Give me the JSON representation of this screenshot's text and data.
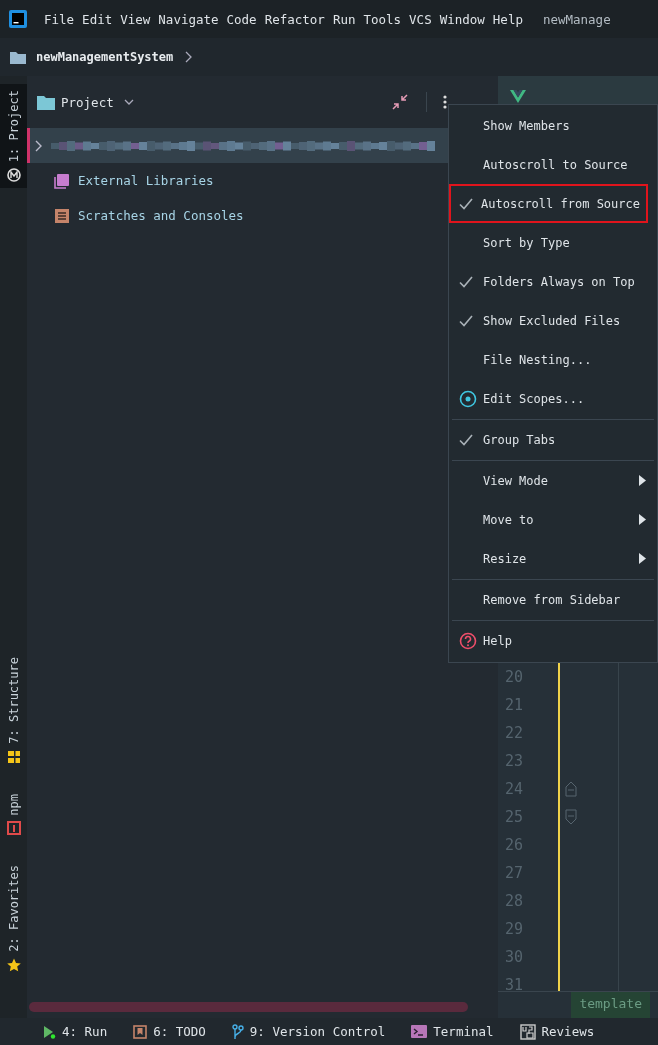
{
  "menubar": {
    "items": [
      "File",
      "Edit",
      "View",
      "Navigate",
      "Code",
      "Refactor",
      "Run",
      "Tools",
      "VCS",
      "Window",
      "Help"
    ],
    "title": "newManage"
  },
  "breadcrumb": {
    "items": [
      "newManagementSystem"
    ]
  },
  "left_toolbar": {
    "top": [
      {
        "label": "1: Project",
        "selected": true
      }
    ],
    "bottom": [
      {
        "label": "7: Structure",
        "selected": false
      },
      {
        "label": "npm",
        "selected": false
      },
      {
        "label": "2: Favorites",
        "selected": false
      }
    ]
  },
  "project_panel": {
    "title": "Project",
    "tree": [
      {
        "kind": "folder",
        "selected": true
      },
      {
        "kind": "libraries",
        "label": "External Libraries",
        "selected": false
      },
      {
        "kind": "scratches",
        "label": "Scratches and Consoles",
        "selected": false
      }
    ]
  },
  "context_menu": {
    "items": [
      {
        "kind": "toggle",
        "label": "Show Members",
        "checked": false,
        "highlighted": false
      },
      {
        "kind": "toggle",
        "label": "Autoscroll to Source",
        "checked": false,
        "highlighted": false
      },
      {
        "kind": "toggle",
        "label": "Autoscroll from Source",
        "checked": true,
        "highlighted": true
      },
      {
        "kind": "toggle",
        "label": "Sort by Type",
        "checked": false,
        "highlighted": false
      },
      {
        "kind": "toggle",
        "label": "Folders Always on Top",
        "checked": true,
        "highlighted": false
      },
      {
        "kind": "toggle",
        "label": "Show Excluded Files",
        "checked": true,
        "highlighted": false
      },
      {
        "kind": "action",
        "label": "File Nesting...",
        "highlighted": false
      },
      {
        "kind": "scopes",
        "label": "Edit Scopes...",
        "highlighted": false
      },
      {
        "kind": "separator"
      },
      {
        "kind": "toggle",
        "label": "Group Tabs",
        "checked": true,
        "highlighted": false
      },
      {
        "kind": "separator"
      },
      {
        "kind": "submenu",
        "label": "View Mode",
        "highlighted": false
      },
      {
        "kind": "submenu",
        "label": "Move to",
        "highlighted": false
      },
      {
        "kind": "submenu",
        "label": "Resize",
        "highlighted": false
      },
      {
        "kind": "separator"
      },
      {
        "kind": "action",
        "label": "Remove from Sidebar",
        "highlighted": false
      },
      {
        "kind": "separator"
      },
      {
        "kind": "help",
        "label": "Help",
        "highlighted": false
      }
    ]
  },
  "editor": {
    "line_numbers": [
      "20",
      "21",
      "22",
      "23",
      "24",
      "25",
      "26",
      "27",
      "28",
      "29",
      "30",
      "31"
    ],
    "breadcrumb": "template"
  },
  "bottom_toolbar": {
    "items": [
      "4: Run",
      "6: TODO",
      "9: Version Control",
      "Terminal",
      "Reviews"
    ]
  }
}
